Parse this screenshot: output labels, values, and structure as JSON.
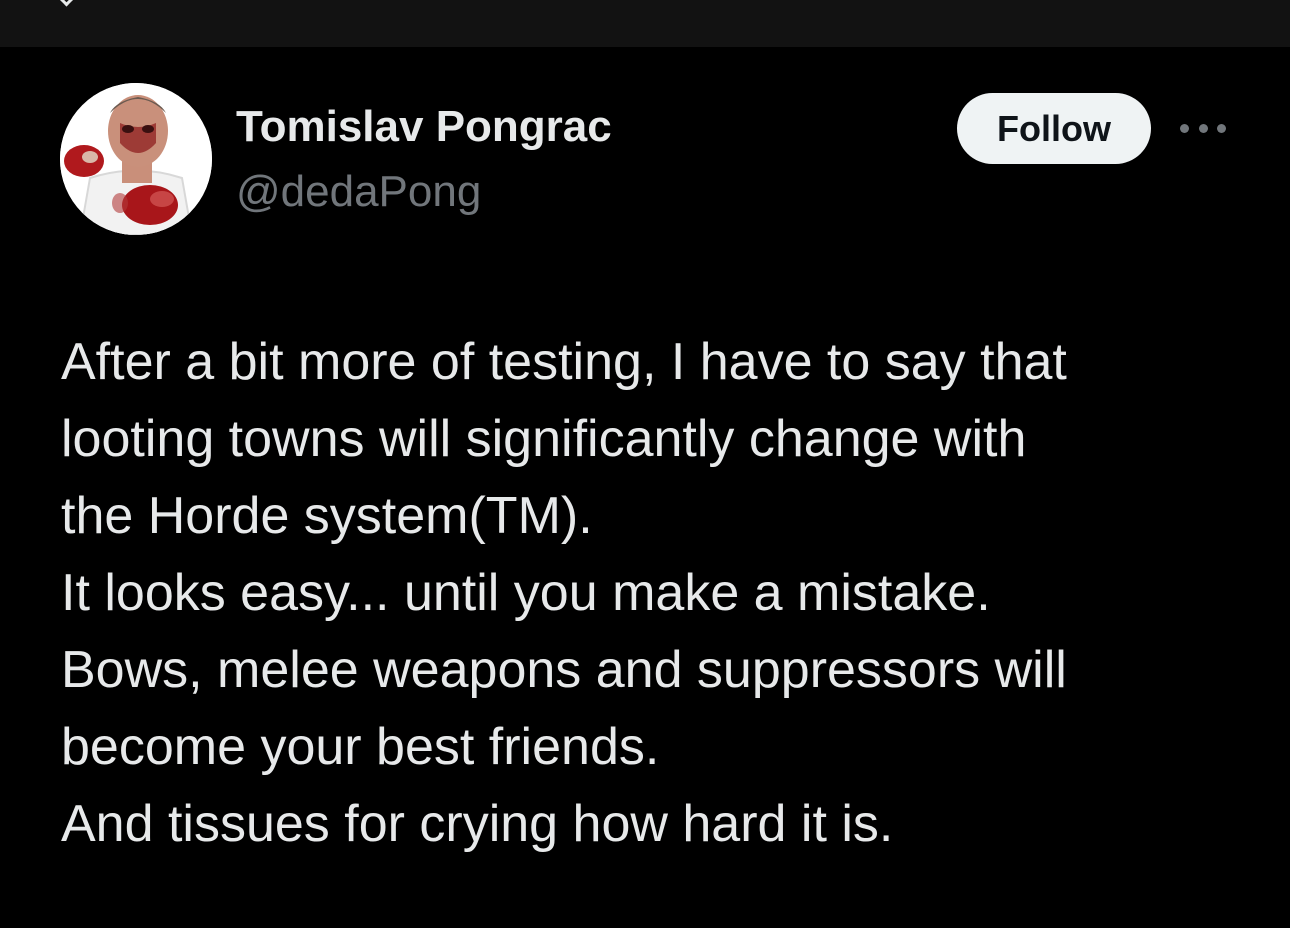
{
  "author": {
    "name": "Tomislav Pongrac",
    "handle": "@dedaPong",
    "avatar_icon": "profile-avatar"
  },
  "actions": {
    "follow_label": "Follow",
    "more_icon": "more-options-icon"
  },
  "tweet": {
    "lines": [
      "After a bit more of testing, I have to say that",
      "looting towns will significantly change with",
      "the Horde system(TM).",
      "It looks easy... until you make a mistake.",
      "Bows, melee weapons and suppressors will",
      "become your best friends.",
      "And tissues for crying how hard it is."
    ]
  },
  "colors": {
    "background": "#000000",
    "text_primary": "#e7e9ea",
    "text_secondary": "#71767b",
    "follow_bg": "#eff3f4",
    "follow_text": "#0f1419"
  }
}
